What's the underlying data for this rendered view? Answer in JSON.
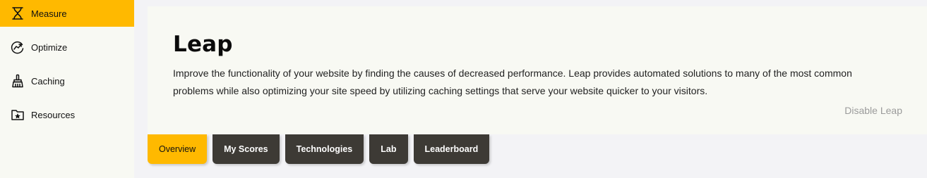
{
  "sidebar": {
    "items": [
      {
        "label": "Measure",
        "icon": "hourglass-icon",
        "active": true
      },
      {
        "label": "Optimize",
        "icon": "trend-up-icon",
        "active": false
      },
      {
        "label": "Caching",
        "icon": "broom-icon",
        "active": false
      },
      {
        "label": "Resources",
        "icon": "folder-star-icon",
        "active": false
      }
    ]
  },
  "main": {
    "title": "Leap",
    "description": "Improve the functionality of your website by finding the causes of decreased performance. Leap provides automated solutions to many of the most common problems while also optimizing your site speed by utilizing caching settings that serve your website quicker to your visitors.",
    "disable_label": "Disable Leap"
  },
  "tabs": [
    {
      "label": "Overview",
      "active": true
    },
    {
      "label": "My Scores",
      "active": false
    },
    {
      "label": "Technologies",
      "active": false
    },
    {
      "label": "Lab",
      "active": false
    },
    {
      "label": "Leaderboard",
      "active": false
    }
  ],
  "colors": {
    "accent": "#ffb900",
    "tab_dark": "#3d3a35",
    "card_bg": "#f8f9f3",
    "page_bg": "#f3f3f6"
  }
}
